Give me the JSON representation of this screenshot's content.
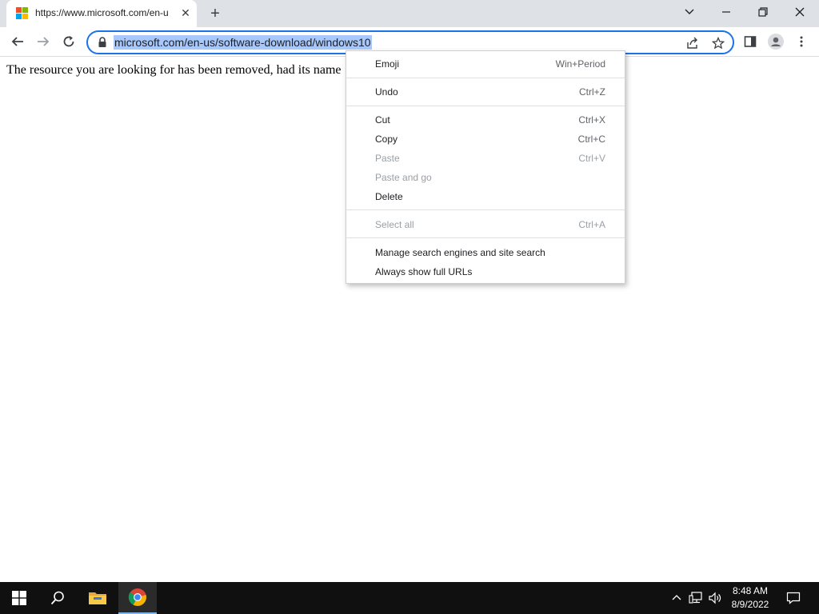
{
  "browser": {
    "tab": {
      "title": "https://www.microsoft.com/en-u",
      "close_glyph": "✕"
    },
    "new_tab_glyph": "+",
    "address_bar": {
      "url": "microsoft.com/en-us/software-download/windows10"
    },
    "window_controls": {
      "chevron": "⌄",
      "minimize": "—",
      "restore": "❐",
      "close": "✕"
    }
  },
  "page": {
    "body_text": "The resource you are looking for has been removed, had its name"
  },
  "context_menu": {
    "items": [
      {
        "label": "Emoji",
        "shortcut": "Win+Period",
        "disabled": false
      },
      {
        "label": "Undo",
        "shortcut": "Ctrl+Z",
        "disabled": false
      },
      {
        "label": "Cut",
        "shortcut": "Ctrl+X",
        "disabled": false
      },
      {
        "label": "Copy",
        "shortcut": "Ctrl+C",
        "disabled": false
      },
      {
        "label": "Paste",
        "shortcut": "Ctrl+V",
        "disabled": true
      },
      {
        "label": "Paste and go",
        "shortcut": "",
        "disabled": true
      },
      {
        "label": "Delete",
        "shortcut": "",
        "disabled": false
      },
      {
        "label": "Select all",
        "shortcut": "Ctrl+A",
        "disabled": true
      },
      {
        "label": "Manage search engines and site search",
        "shortcut": "",
        "disabled": false
      },
      {
        "label": "Always show full URLs",
        "shortcut": "",
        "disabled": false
      }
    ]
  },
  "taskbar": {
    "time": "8:48 AM",
    "date": "8/9/2022"
  },
  "colors": {
    "accent": "#1a73e8",
    "url_selection": "#a8c7fa",
    "tabstrip_bg": "#dee1e6",
    "taskbar_bg": "#101010"
  },
  "icons": [
    "microsoft-logo-icon",
    "back-arrow-icon",
    "forward-arrow-icon",
    "reload-icon",
    "lock-icon",
    "share-icon",
    "star-icon",
    "side-panel-icon",
    "profile-icon",
    "kebab-menu-icon",
    "windows-start-icon",
    "search-icon",
    "file-explorer-icon",
    "chrome-icon",
    "chevron-up-icon",
    "network-icon",
    "volume-icon",
    "notification-icon"
  ]
}
